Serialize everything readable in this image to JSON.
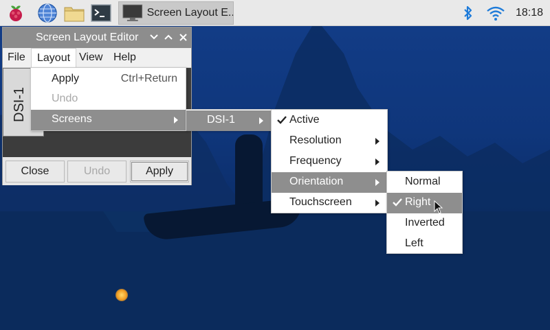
{
  "taskbar": {
    "task_title": "Screen Layout E..",
    "clock": "18:18"
  },
  "window": {
    "title": "Screen Layout Editor",
    "menus": [
      "File",
      "Layout",
      "View",
      "Help"
    ],
    "screen_label": "DSI-1",
    "buttons": {
      "close": "Close",
      "undo": "Undo",
      "apply": "Apply"
    }
  },
  "layout_menu": {
    "apply": "Apply",
    "apply_shortcut": "Ctrl+Return",
    "undo": "Undo",
    "screens": "Screens"
  },
  "screens_menu": {
    "item": "DSI-1"
  },
  "dsi_menu": {
    "active": "Active",
    "resolution": "Resolution",
    "frequency": "Frequency",
    "orientation": "Orientation",
    "touchscreen": "Touchscreen"
  },
  "orientation_menu": {
    "normal": "Normal",
    "right": "Right",
    "inverted": "Inverted",
    "left": "Left",
    "selected": "Right"
  },
  "colors": {
    "highlight": "#8e8e8e",
    "titlebar": "#8d8d8d",
    "taskbar": "#e9e9e9",
    "bluetooth": "#1e7bd9"
  }
}
